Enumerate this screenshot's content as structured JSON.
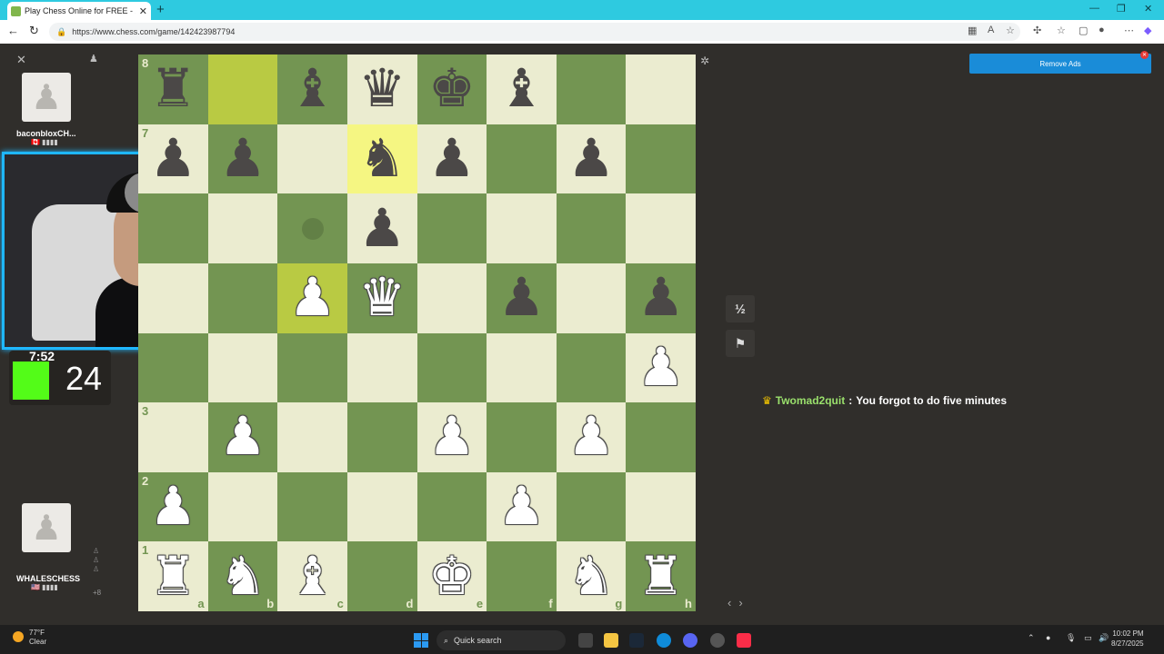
{
  "browser": {
    "tab_title": "Play Chess Online for FREE - 2 Pla",
    "url": "https://www.chess.com/game/142423987794",
    "new_tab": "+",
    "tab_close": "✕"
  },
  "players": {
    "top": {
      "name": "baconbloxCH...",
      "flag": "CA"
    },
    "bottom": {
      "name": "WHALESCHESS",
      "flag": "US",
      "captured_extra": "+8"
    }
  },
  "stream": {
    "timer": "7:52",
    "count": "24"
  },
  "board": {
    "ranks_shown": [
      "8",
      "7",
      "3",
      "2",
      "1"
    ],
    "files": [
      "a",
      "b",
      "c",
      "d",
      "e",
      "f",
      "g",
      "h"
    ],
    "pieces": {
      "a8": "♜",
      "c8": "♝",
      "d8": "♛",
      "e8": "♚",
      "f8": "♝",
      "a7": "♟",
      "b7": "♟",
      "d7": "♞",
      "e7": "♟",
      "g7": "♟",
      "d6": "♟",
      "c5": "♙",
      "d5": "♕",
      "f5": "♟",
      "h5": "♟",
      "h4": "♙",
      "b3": "♙",
      "e3": "♙",
      "g3": "♙",
      "a2": "♙",
      "f2": "♙",
      "a1": "♖",
      "b1": "♘",
      "c1": "♗",
      "e1": "♔",
      "g1": "♘",
      "h1": "♖"
    },
    "colors": {
      "light": "#ebecd0",
      "dark": "#739552",
      "highlight_dark": "#b9ca43",
      "highlight_light": "#f5f682"
    }
  },
  "controls": {
    "draw": "½",
    "resign": "⚑",
    "remove_ads": "Remove Ads"
  },
  "chat": {
    "user": "Twomad2quit",
    "separator": ":",
    "message": "You forgot to do five minutes"
  },
  "taskbar": {
    "temp": "77°F",
    "condition": "Clear",
    "search": "Quick search",
    "time": "10:02 PM",
    "date": "8/27/2025"
  }
}
